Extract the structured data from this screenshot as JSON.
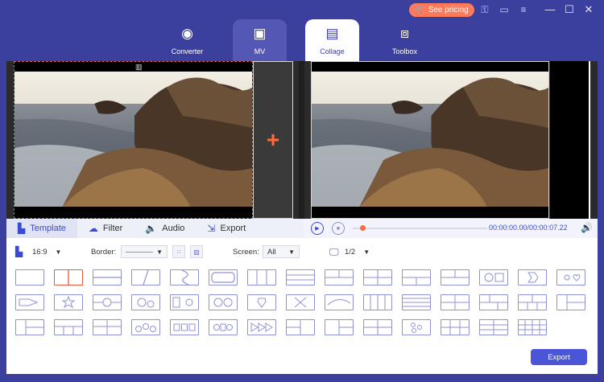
{
  "header": {
    "pricing_label": "See pricing",
    "tabs": [
      {
        "label": "Converter",
        "icon": "converter-icon"
      },
      {
        "label": "MV",
        "icon": "mv-icon"
      },
      {
        "label": "Collage",
        "icon": "collage-icon",
        "active": true
      },
      {
        "label": "Toolbox",
        "icon": "toolbox-icon"
      }
    ]
  },
  "panel": {
    "subtabs": [
      {
        "label": "Template",
        "active": true
      },
      {
        "label": "Filter"
      },
      {
        "label": "Audio"
      },
      {
        "label": "Export"
      }
    ],
    "ratio": "16:9",
    "border_label": "Border:",
    "screen_label": "Screen:",
    "screen_value": "All",
    "page_value": "1/2",
    "time": "00:00:00.00/00:00:07.22",
    "playback_progress": 0.0,
    "export_label": "Export"
  },
  "colors": {
    "brand": "#3b3f9e",
    "accent": "#ff6a3d",
    "button": "#4a55d8",
    "template_stroke": "#8d93d4"
  }
}
